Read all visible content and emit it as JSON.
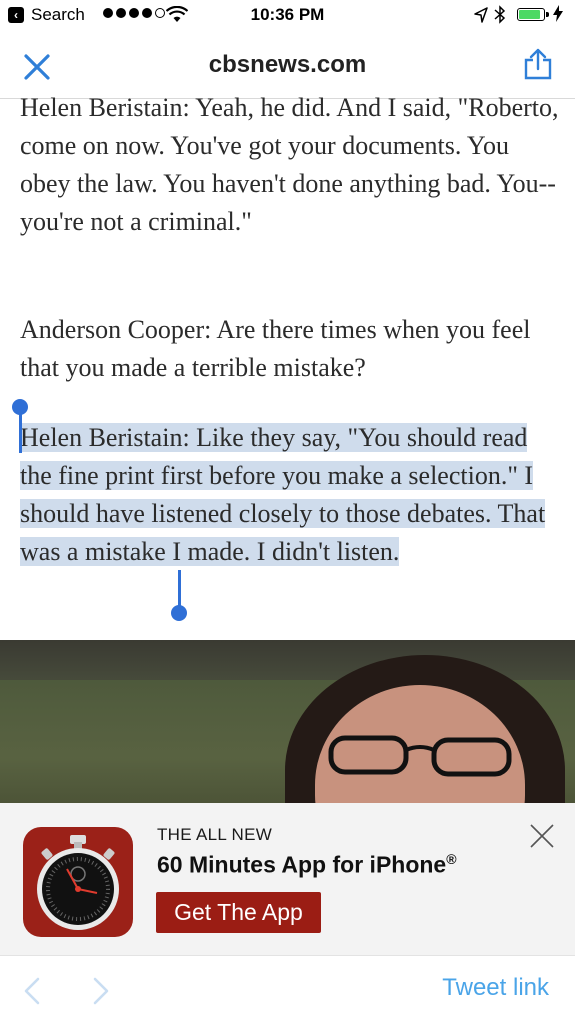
{
  "status_bar": {
    "back_app": "Search",
    "time": "10:36 PM",
    "signal_bars": 4,
    "battery_fraction": 0.8
  },
  "nav": {
    "domain": "cbsnews.com",
    "close_icon": "close-icon",
    "share_icon": "share-icon"
  },
  "article": {
    "paragraph1": "Helen Beristain: Yeah, he did. And I said, \"Roberto, come on now. You've got your documents. You obey the law. You haven't done anything bad. You-- you're not a criminal.\"",
    "paragraph2": "Anderson Cooper: Are there times when you feel that you made a terrible mistake?",
    "paragraph3_selected": "Helen Beristain: Like they say, \"You should read the fine print first before you make a selection.\" I should have listened closely to those debates. That was a mistake I made. I didn't listen."
  },
  "banner": {
    "eyebrow": "THE ALL NEW",
    "title": "60 Minutes App for iPhone",
    "title_mark": "®",
    "cta": "Get The App"
  },
  "toolbar": {
    "tweet_link": "Tweet link"
  },
  "colors": {
    "accent_blue": "#2f7fd8",
    "selection": "#cfdcec",
    "brand_red": "#9b1d14",
    "tweet_blue": "#4aa4e8"
  }
}
